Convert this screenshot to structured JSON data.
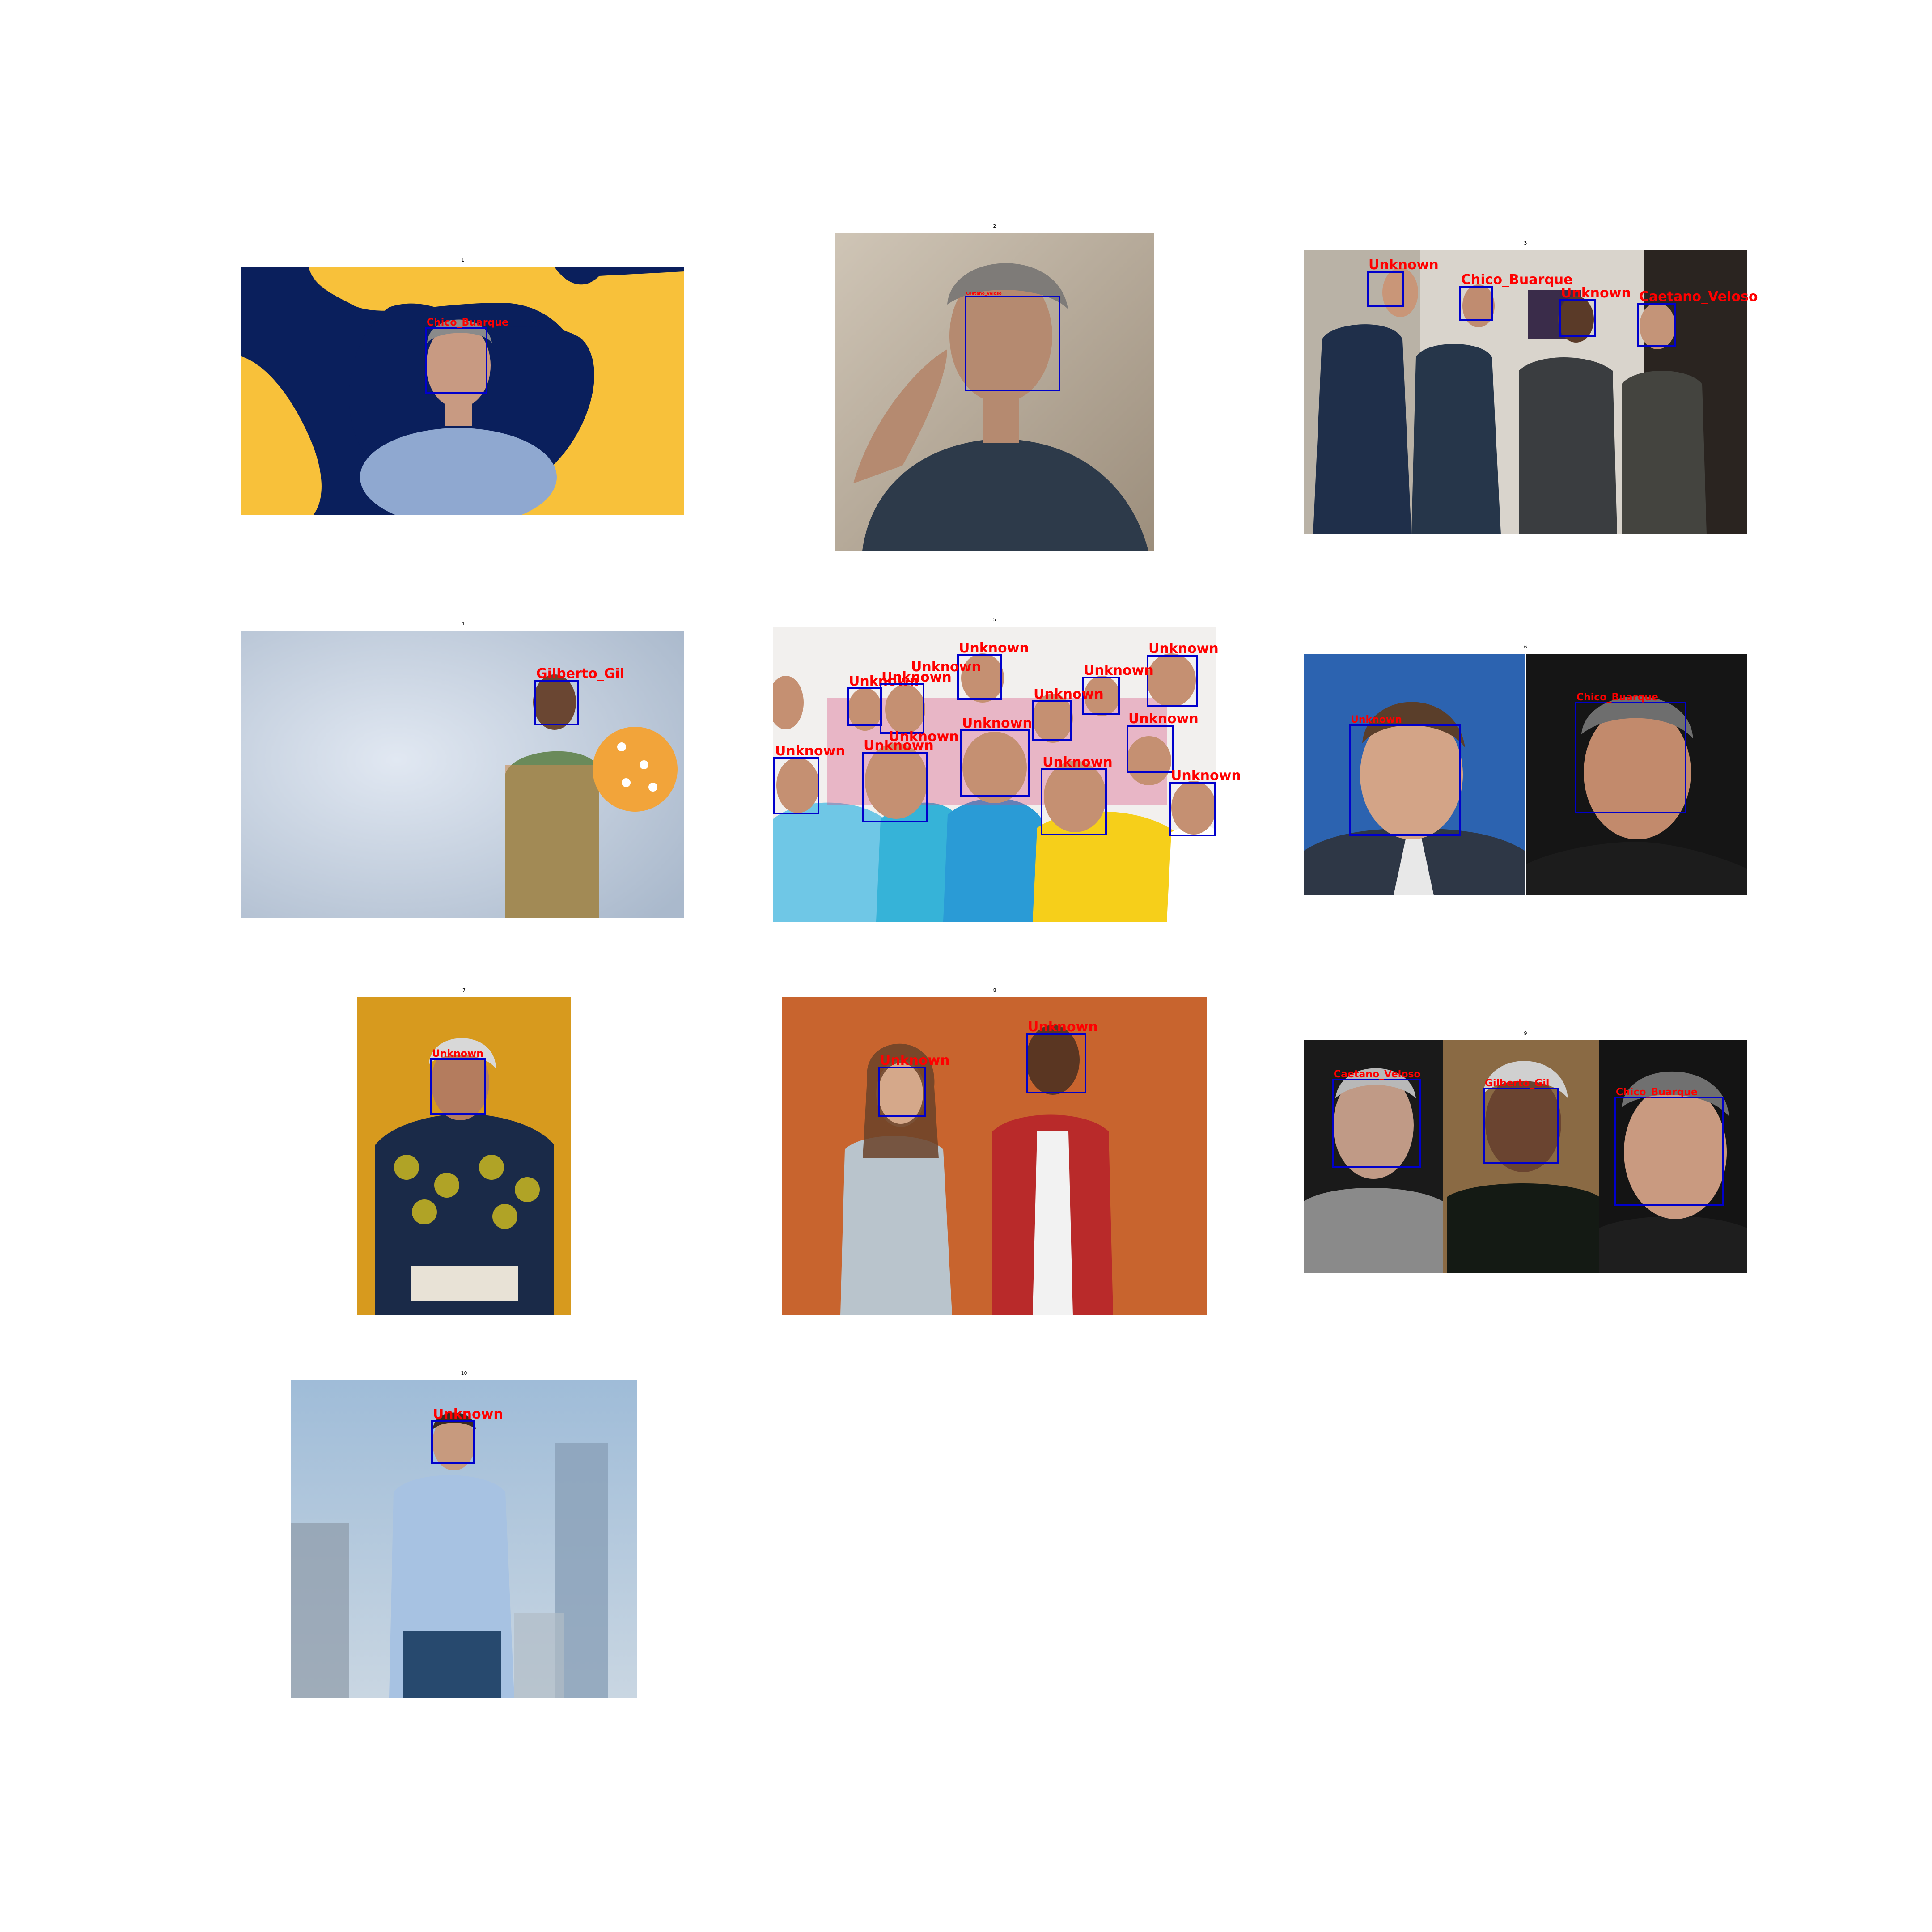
{
  "figure": {
    "panels": [
      {
        "title": "1",
        "faces": [
          {
            "label": "Chico_Buarque"
          }
        ]
      },
      {
        "title": "2",
        "faces": [
          {
            "label": "Caetano_Veloso"
          }
        ]
      },
      {
        "title": "3",
        "faces": [
          {
            "label": "Unknown"
          },
          {
            "label": "Chico_Buarque"
          },
          {
            "label": "Unknown"
          },
          {
            "label": "Caetano_Veloso"
          }
        ]
      },
      {
        "title": "4",
        "faces": [
          {
            "label": "Gilberto_Gil"
          }
        ]
      },
      {
        "title": "5",
        "faces": [
          {
            "label": "Unknown"
          },
          {
            "label": "Unknown"
          },
          {
            "label": "Unknown"
          },
          {
            "label": "Unknown"
          },
          {
            "label": "Unknown"
          },
          {
            "label": "Unknown"
          },
          {
            "label": "Unknown"
          },
          {
            "label": "Unknown"
          },
          {
            "label": "Unknown"
          },
          {
            "label": "Unknown"
          },
          {
            "label": "Unknown"
          },
          {
            "label": "Unknown"
          },
          {
            "label": "Unknown"
          },
          {
            "label": "Unknown"
          }
        ]
      },
      {
        "title": "6",
        "faces": [
          {
            "label": "Unknown"
          },
          {
            "label": "Chico_Buarque"
          }
        ]
      },
      {
        "title": "7",
        "faces": [
          {
            "label": "Unknown"
          }
        ]
      },
      {
        "title": "8",
        "faces": [
          {
            "label": "Unknown"
          },
          {
            "label": "Unknown"
          }
        ]
      },
      {
        "title": "9",
        "faces": [
          {
            "label": "Caetano_Veloso"
          },
          {
            "label": "Gilberto_Gil"
          },
          {
            "label": "Chico_Buarque"
          }
        ]
      },
      {
        "title": "10",
        "faces": [
          {
            "label": "Unknown"
          }
        ]
      }
    ]
  },
  "colors": {
    "box": "#0000cc",
    "label": "#ff0000"
  }
}
